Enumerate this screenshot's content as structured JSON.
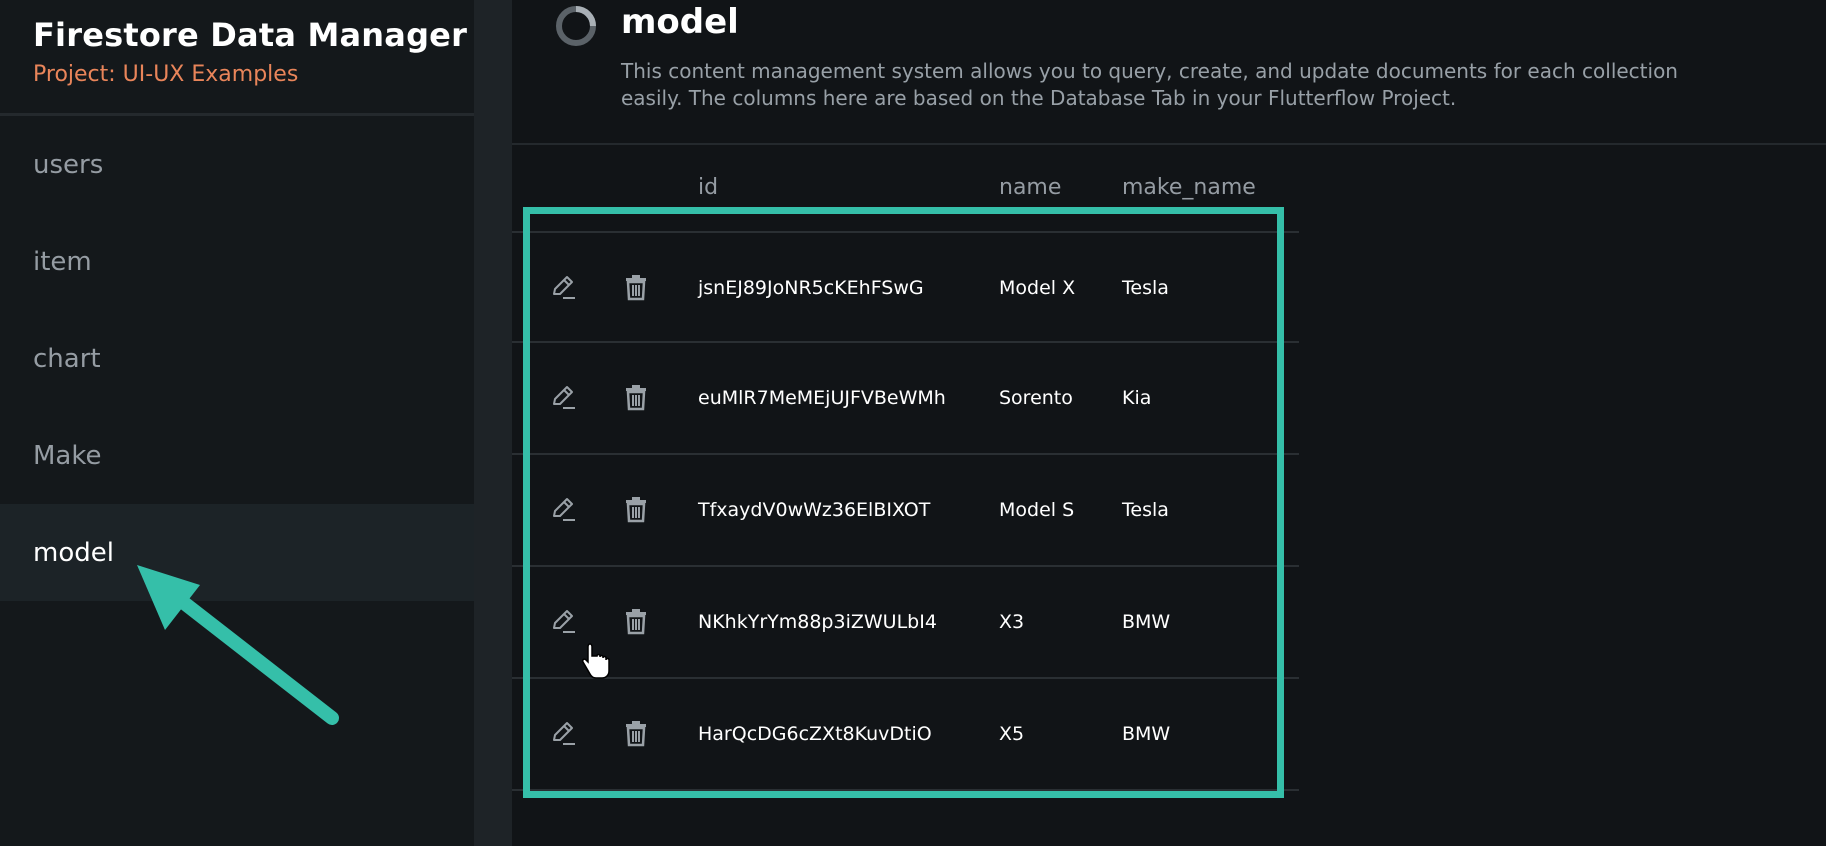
{
  "sidebar": {
    "title": "Firestore Data Manager",
    "project": "Project: UI-UX Examples",
    "items": [
      {
        "label": "users"
      },
      {
        "label": "item"
      },
      {
        "label": "chart"
      },
      {
        "label": "Make"
      },
      {
        "label": "model"
      }
    ],
    "active_item": "model"
  },
  "main": {
    "title": "model",
    "description": "This content management system allows you to query, create, and update documents for each collection easily. The columns here are based on the Database Tab in your Flutterflow Project.",
    "columns": [
      "id",
      "name",
      "make_name"
    ],
    "rows": [
      {
        "id": "jsnEJ89JoNR5cKEhFSwG",
        "name": "Model X",
        "make_name": "Tesla"
      },
      {
        "id": "euMlR7MeMEjUJFVBeWMh",
        "name": "Sorento",
        "make_name": "Kia"
      },
      {
        "id": "TfxaydV0wWz36ElBIXOT",
        "name": "Model S",
        "make_name": "Tesla"
      },
      {
        "id": "NKhkYrYm88p3iZWULbI4",
        "name": "X3",
        "make_name": "BMW"
      },
      {
        "id": "HarQcDG6cZXt8KuvDtiO",
        "name": "X5",
        "make_name": "BMW"
      }
    ]
  },
  "icons": {
    "edit": "pencil-icon",
    "delete": "trash-icon",
    "collection": "ring-icon"
  },
  "colors": {
    "accent": "#35bfa9",
    "project": "#e9855a",
    "background": "#111417",
    "sidebar": "#14181b",
    "active_item": "#1c2327"
  }
}
